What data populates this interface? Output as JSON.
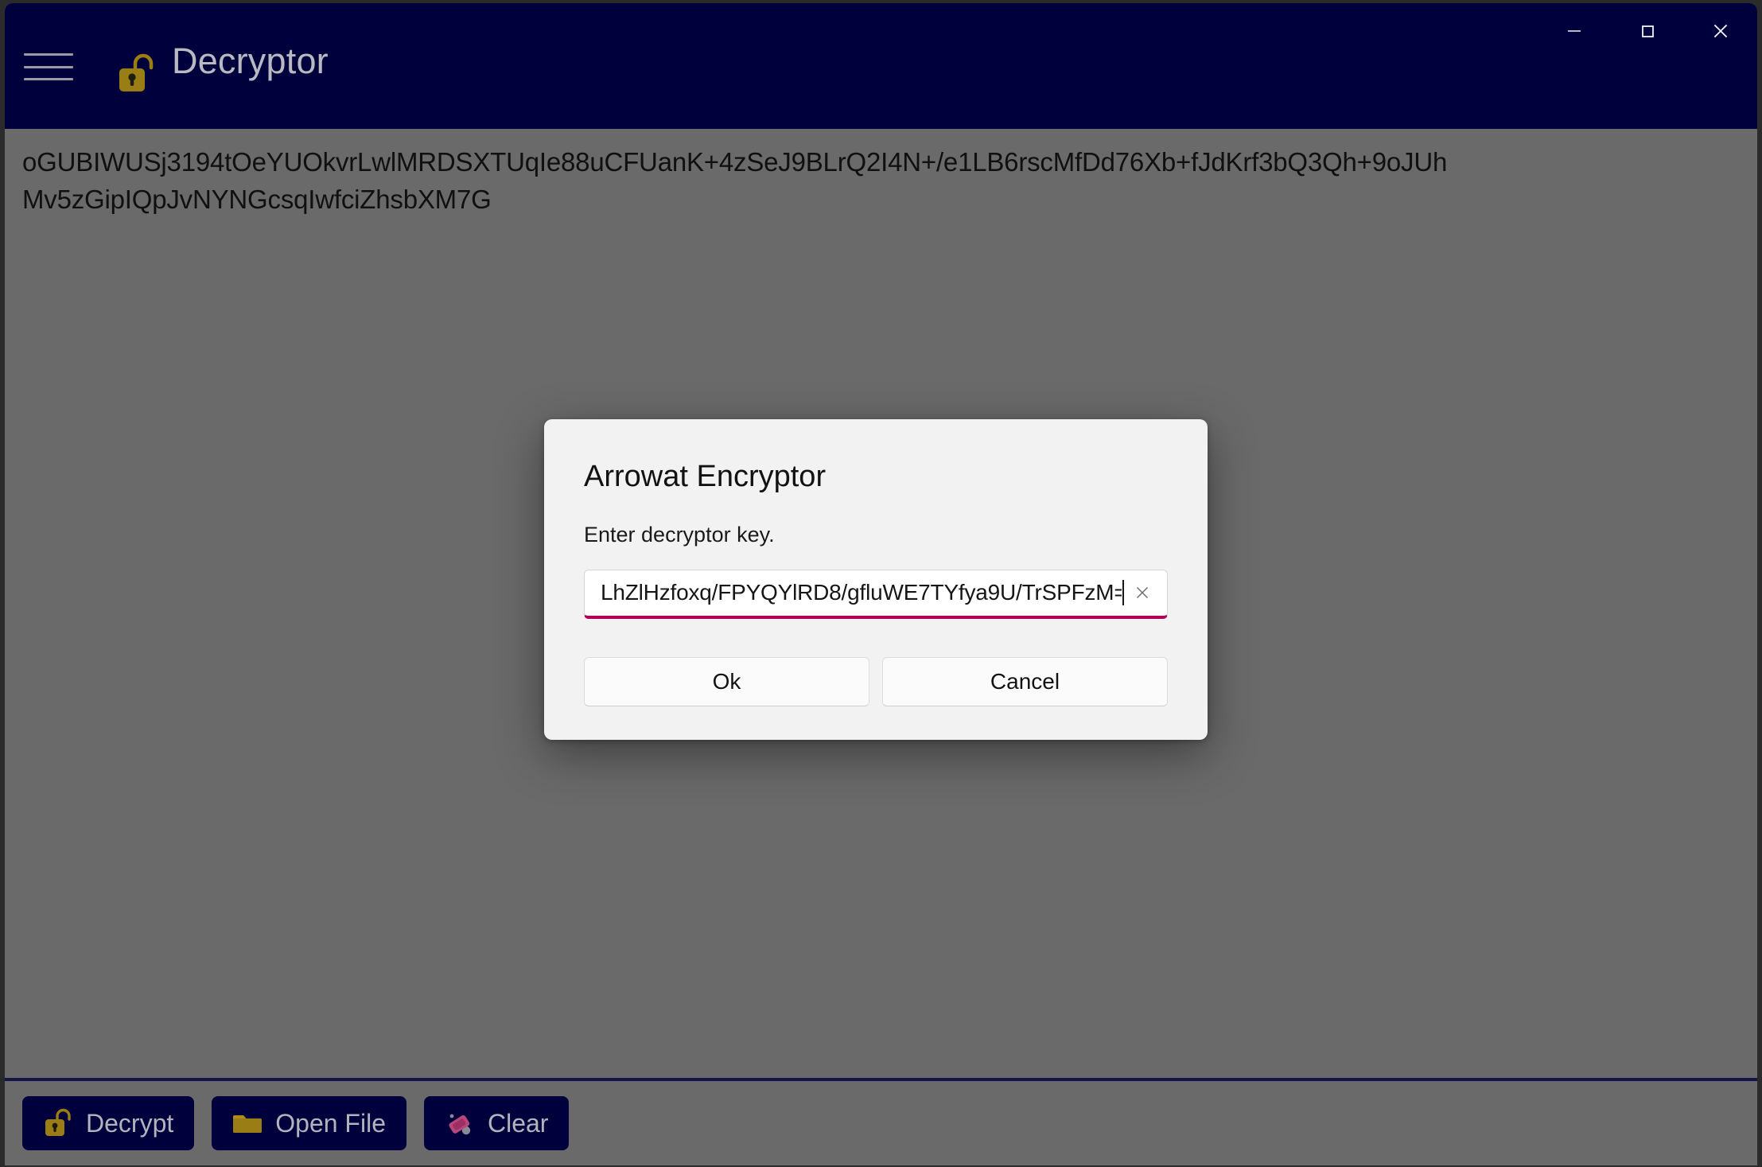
{
  "window": {
    "title": "Decryptor",
    "title_icon": "unlock-padlock-icon",
    "menu_icon": "hamburger-menu-icon",
    "controls": {
      "minimize": "minimize-icon",
      "maximize": "maximize-icon",
      "close": "close-icon"
    }
  },
  "main": {
    "cipher_text": "oGUBIWUSj3194tOeYUOkvrLwlMRDSXTUqIe88uCFUanK+4zSeJ9BLrQ2I4N+/e1LB6rscMfDd76Xb+fJdKrf3bQ3Qh+9oJUhMv5zGipIQpJvNYNGcsqIwfciZhsbXM7G"
  },
  "commandbar": {
    "buttons": [
      {
        "label": "Decrypt",
        "icon": "unlock-padlock-icon"
      },
      {
        "label": "Open File",
        "icon": "folder-icon"
      },
      {
        "label": "Clear",
        "icon": "eraser-icon"
      }
    ]
  },
  "dialog": {
    "title": "Arrowat Encryptor",
    "message": "Enter decryptor key.",
    "input": {
      "value": "LhZlHzfoxq/FPYQYlRD8/gfluWE7TYfya9U/TrSPFzM=",
      "placeholder": "",
      "clear_icon": "clear-x-icon"
    },
    "ok_label": "Ok",
    "cancel_label": "Cancel"
  },
  "colors": {
    "titlebar": "#00003c",
    "content": "#6a6a6a",
    "accent_underline": "#b5005a",
    "icon_gold": "#9a7d14",
    "icon_pink": "#b8467a",
    "dialog_bg": "#f2f2f2"
  }
}
